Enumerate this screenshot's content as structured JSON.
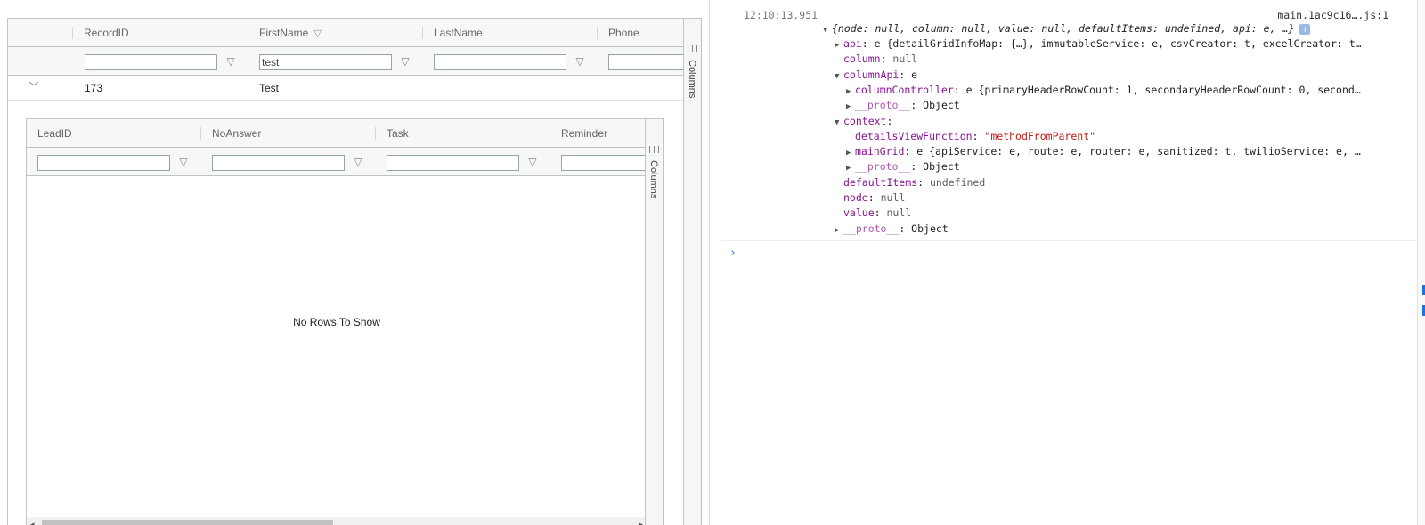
{
  "outer_grid": {
    "columns": [
      "RecordID",
      "FirstName",
      "LastName",
      "Phone"
    ],
    "filter_values": [
      "",
      "test",
      "",
      ""
    ],
    "row": {
      "record_id": "173",
      "first_name": "Test"
    },
    "side_panel_label": "Columns"
  },
  "detail_grid": {
    "columns": [
      "LeadID",
      "NoAnswer",
      "Task",
      "Reminder"
    ],
    "filter_values": [
      "",
      "",
      "",
      ""
    ],
    "empty_message": "No Rows To Show",
    "side_panel_label": "Columns"
  },
  "console": {
    "timestamp": "12:10:13.951",
    "source": "main.1ac9c16….js:1",
    "summary": "{node: null, column: null, value: null, defaultItems: undefined, api: e, …}",
    "api_preview": "e {detailGridInfoMap: {…}, immutableService: e, csvCreator: t, excelCreator: t…",
    "column_key": "column",
    "column_value": "null",
    "column_api_key": "columnApi",
    "column_api_value": "e",
    "column_controller_preview": "e {primaryHeaderRowCount: 1, secondaryHeaderRowCount: 0, second…",
    "proto_key": "__proto__",
    "proto_value": "Object",
    "context_key": "context",
    "details_view_fn_key": "detailsViewFunction",
    "details_view_fn_value": "\"methodFromParent\"",
    "main_grid_key": "mainGrid",
    "main_grid_preview": "e {apiService: e, route: e, router: e, sanitized: t, twilioService: e, …",
    "default_items_key": "defaultItems",
    "default_items_value": "undefined",
    "node_key": "node",
    "node_value": "null",
    "value_key": "value",
    "value_value": "null",
    "api_key": "api",
    "column_controller_key": "columnController",
    "info_badge": "i",
    "prompt": "›"
  },
  "icons": {
    "filter": "funnel-icon",
    "chevron": "chevron-down-icon",
    "expand": "triangle-right-icon",
    "collapse": "triangle-down-icon",
    "scroll_left": "arrow-left-icon",
    "scroll_right": "arrow-right-icon"
  }
}
